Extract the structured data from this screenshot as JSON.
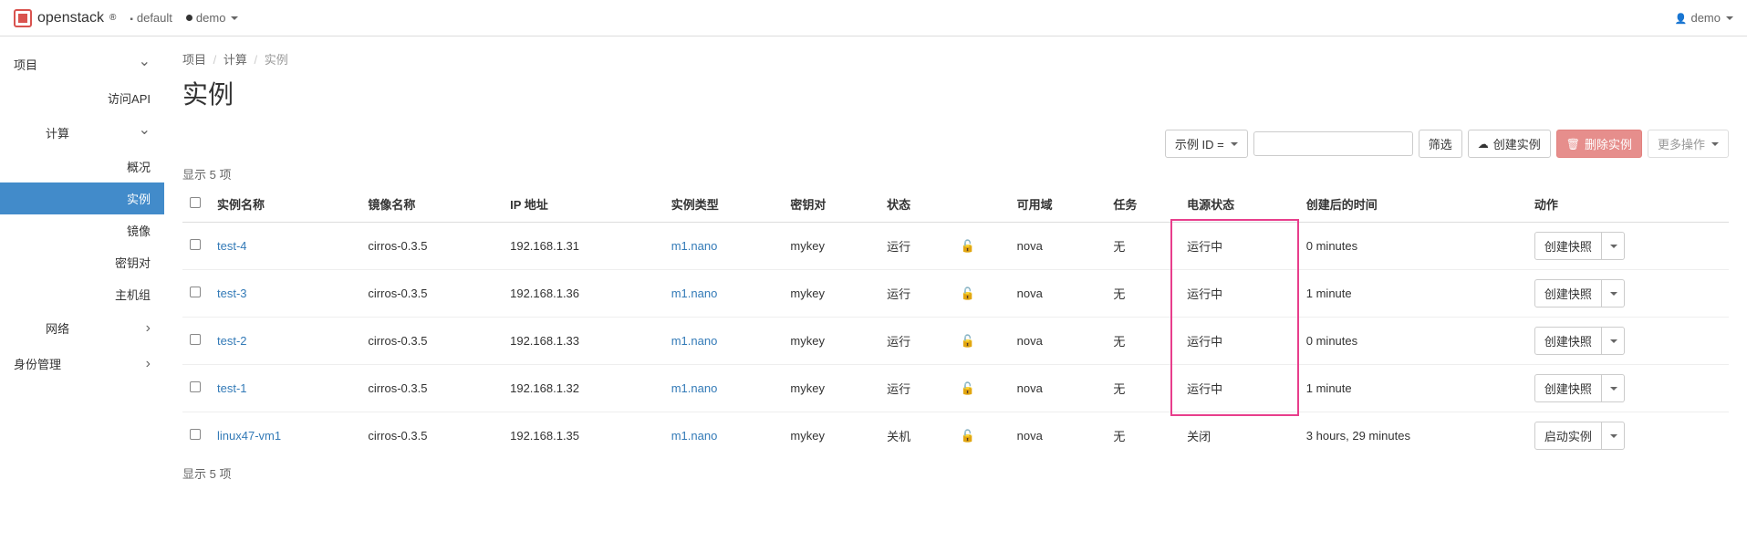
{
  "topbar": {
    "brand": "openstack",
    "domain_label": "default",
    "project_label": "demo",
    "user_label": "demo"
  },
  "sidebar": {
    "project": {
      "label": "项目",
      "expanded": true
    },
    "api": "访问API",
    "compute": {
      "label": "计算",
      "expanded": true
    },
    "compute_items": {
      "overview": "概况",
      "instances": "实例",
      "images": "镜像",
      "keypairs": "密钥对",
      "server_groups": "主机组"
    },
    "network": {
      "label": "网络"
    },
    "identity": {
      "label": "身份管理"
    }
  },
  "breadcrumb": {
    "a": "项目",
    "b": "计算",
    "c": "实例"
  },
  "page_title": "实例",
  "toolbar": {
    "filter_field": "示例 ID =",
    "filter_placeholder": "",
    "filter_btn": "筛选",
    "launch_btn": "创建实例",
    "delete_btn": "删除实例",
    "more_btn": "更多操作"
  },
  "count_text": "显示 5 项",
  "columns": {
    "name": "实例名称",
    "image": "镜像名称",
    "ip": "IP 地址",
    "flavor": "实例类型",
    "keypair": "密钥对",
    "status": "状态",
    "zone": "可用域",
    "task": "任务",
    "power": "电源状态",
    "age": "创建后的时间",
    "actions": "动作"
  },
  "rows": [
    {
      "name": "test-4",
      "image": "cirros-0.3.5",
      "ip": "192.168.1.31",
      "flavor": "m1.nano",
      "keypair": "mykey",
      "status": "运行",
      "zone": "nova",
      "task": "无",
      "power": "运行中",
      "age": "0 minutes",
      "action": "创建快照"
    },
    {
      "name": "test-3",
      "image": "cirros-0.3.5",
      "ip": "192.168.1.36",
      "flavor": "m1.nano",
      "keypair": "mykey",
      "status": "运行",
      "zone": "nova",
      "task": "无",
      "power": "运行中",
      "age": "1 minute",
      "action": "创建快照"
    },
    {
      "name": "test-2",
      "image": "cirros-0.3.5",
      "ip": "192.168.1.33",
      "flavor": "m1.nano",
      "keypair": "mykey",
      "status": "运行",
      "zone": "nova",
      "task": "无",
      "power": "运行中",
      "age": "0 minutes",
      "action": "创建快照"
    },
    {
      "name": "test-1",
      "image": "cirros-0.3.5",
      "ip": "192.168.1.32",
      "flavor": "m1.nano",
      "keypair": "mykey",
      "status": "运行",
      "zone": "nova",
      "task": "无",
      "power": "运行中",
      "age": "1 minute",
      "action": "创建快照"
    },
    {
      "name": "linux47-vm1",
      "image": "cirros-0.3.5",
      "ip": "192.168.1.35",
      "flavor": "m1.nano",
      "keypair": "mykey",
      "status": "关机",
      "zone": "nova",
      "task": "无",
      "power": "关闭",
      "age": "3 hours, 29 minutes",
      "action": "启动实例"
    }
  ]
}
